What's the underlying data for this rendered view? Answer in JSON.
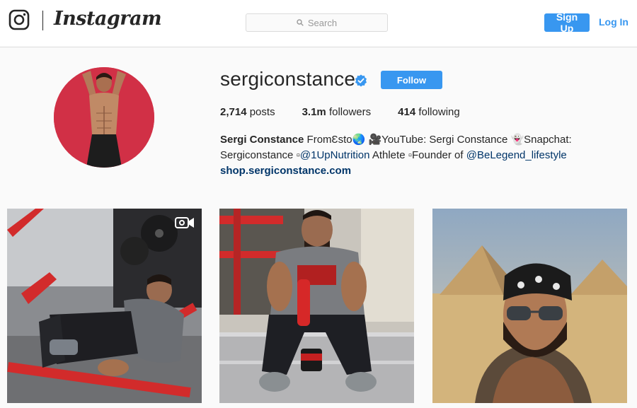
{
  "nav": {
    "logo_text": "Instagram",
    "search_placeholder": "Search",
    "signup_label": "Sign Up",
    "login_label": "Log In"
  },
  "profile": {
    "username": "sergiconstance",
    "verified": true,
    "follow_label": "Follow",
    "stats": [
      {
        "value": "2,714",
        "label": "posts"
      },
      {
        "value": "3.1m",
        "label": "followers"
      },
      {
        "value": "414",
        "label": "following"
      }
    ],
    "bio": {
      "full_name": "Sergi Constance",
      "line1_rest": "FromƐsto🌏 🎥YouTube: Sergi Constance 👻Snapchat:",
      "line2_pre": "Sergiconstance ▫",
      "mention1": "@1UpNutrition",
      "line2_mid": " Athlete ▫Founder of ",
      "mention2": "@BeLegend_lifestyle",
      "website": "shop.sergiconstance.com"
    }
  },
  "posts": [
    {
      "type": "video",
      "icon": "video-camera-icon"
    },
    {
      "type": "photo"
    },
    {
      "type": "photo"
    }
  ],
  "colors": {
    "accent": "#3897f0",
    "link": "#003569",
    "avatar_bg": "#d9344b"
  }
}
